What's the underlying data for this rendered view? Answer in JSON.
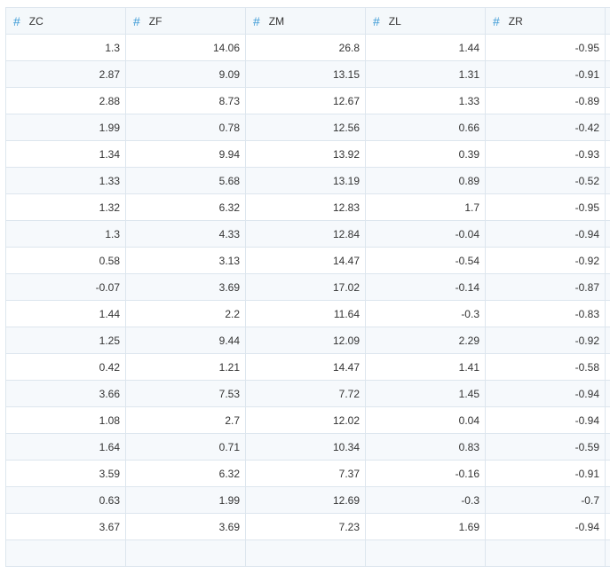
{
  "columns": [
    "ZC",
    "ZF",
    "ZM",
    "ZL",
    "ZR"
  ],
  "column_icon": "hash-icon",
  "colors": {
    "accent": "#3d9bd6",
    "header_bg": "#f4f8fb",
    "alt_row_bg": "#f6f9fc",
    "border": "#dde6ee"
  },
  "rows": [
    [
      "1.3",
      "14.06",
      "26.8",
      "1.44",
      "-0.95"
    ],
    [
      "2.87",
      "9.09",
      "13.15",
      "1.31",
      "-0.91"
    ],
    [
      "2.88",
      "8.73",
      "12.67",
      "1.33",
      "-0.89"
    ],
    [
      "1.99",
      "0.78",
      "12.56",
      "0.66",
      "-0.42"
    ],
    [
      "1.34",
      "9.94",
      "13.92",
      "0.39",
      "-0.93"
    ],
    [
      "1.33",
      "5.68",
      "13.19",
      "0.89",
      "-0.52"
    ],
    [
      "1.32",
      "6.32",
      "12.83",
      "1.7",
      "-0.95"
    ],
    [
      "1.3",
      "4.33",
      "12.84",
      "-0.04",
      "-0.94"
    ],
    [
      "0.58",
      "3.13",
      "14.47",
      "-0.54",
      "-0.92"
    ],
    [
      "-0.07",
      "3.69",
      "17.02",
      "-0.14",
      "-0.87"
    ],
    [
      "1.44",
      "2.2",
      "11.64",
      "-0.3",
      "-0.83"
    ],
    [
      "1.25",
      "9.44",
      "12.09",
      "2.29",
      "-0.92"
    ],
    [
      "0.42",
      "1.21",
      "14.47",
      "1.41",
      "-0.58"
    ],
    [
      "3.66",
      "7.53",
      "7.72",
      "1.45",
      "-0.94"
    ],
    [
      "1.08",
      "2.7",
      "12.02",
      "0.04",
      "-0.94"
    ],
    [
      "1.64",
      "0.71",
      "10.34",
      "0.83",
      "-0.59"
    ],
    [
      "3.59",
      "6.32",
      "7.37",
      "-0.16",
      "-0.91"
    ],
    [
      "0.63",
      "1.99",
      "12.69",
      "-0.3",
      "-0.7"
    ],
    [
      "3.67",
      "3.69",
      "7.23",
      "1.69",
      "-0.94"
    ],
    [
      "",
      "",
      "",
      "",
      ""
    ]
  ]
}
